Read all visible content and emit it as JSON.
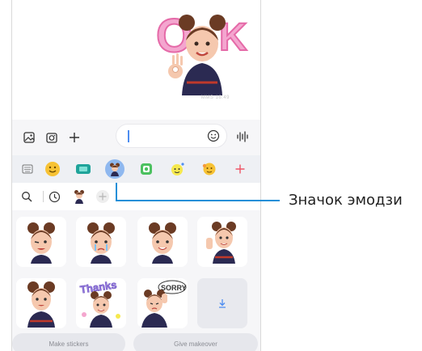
{
  "chat": {
    "timestamp": "MMS 16:49"
  },
  "compose": {
    "gallery_icon": "image-icon",
    "camera_icon": "camera-icon",
    "add_icon": "plus-icon",
    "emoji_icon": "smiley-icon",
    "voice_icon": "voice-waveform-icon"
  },
  "categories": {
    "items": [
      "keyboard-icon",
      "emoji-icon",
      "gif-icon",
      "ar-emoji-icon",
      "sticker-icon",
      "bitmoji-icon",
      "avatar-sticker-icon",
      "add-icon"
    ],
    "selected": "ar-emoji-icon",
    "accent": "#8fb8ef"
  },
  "subbar": {
    "items": [
      "search-icon",
      "recent-icon",
      "avatar-icon",
      "add-icon"
    ]
  },
  "grid": {
    "download_icon": "download-icon",
    "make_stickers_label": "Make stickers",
    "give_makeover_label": "Give makeover"
  },
  "callout": {
    "label": "Значок эмодзи",
    "color": "#1f8fd8"
  }
}
